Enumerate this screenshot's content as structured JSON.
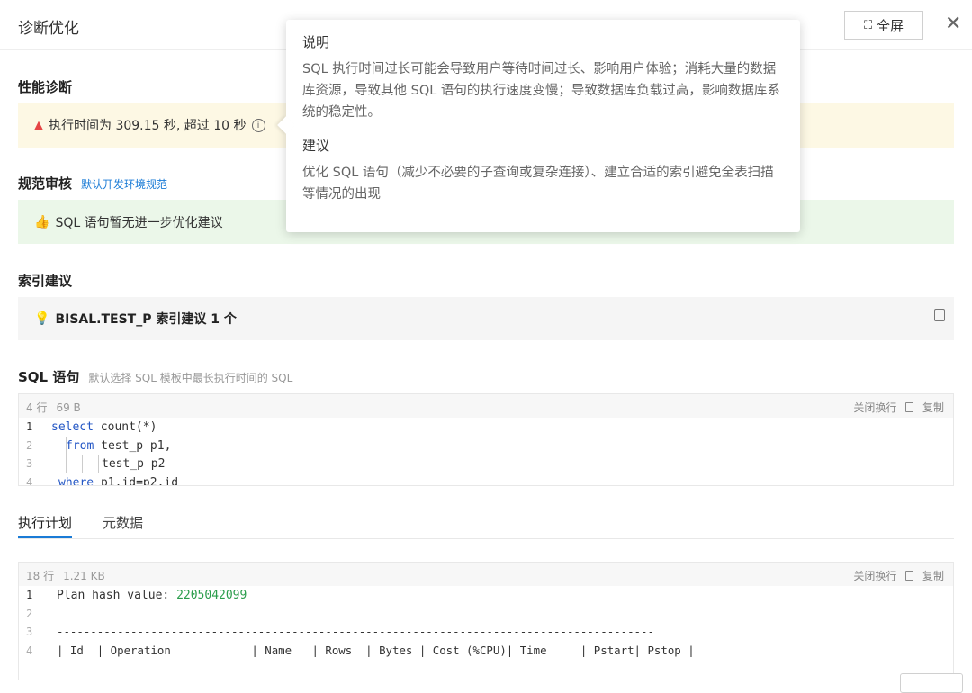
{
  "header": {
    "title": "诊断优化",
    "fullscreen_label": "全屏",
    "fullscreen_icon": "⛶"
  },
  "perf": {
    "title": "性能诊断",
    "warning": "执行时间为 309.15 秒, 超过 10 秒"
  },
  "review": {
    "title": "规范审核",
    "link": "默认开发环境规范",
    "message": "SQL 语句暂无进一步优化建议"
  },
  "index": {
    "title": "索引建议",
    "text": "BISAL.TEST_P 索引建议 1 个"
  },
  "sql": {
    "title": "SQL 语句",
    "subtitle": "默认选择 SQL 模板中最长执行时间的 SQL",
    "lines_count": "4 行",
    "size": "69 B",
    "wrap_label": "关闭换行",
    "copy_label": "复制",
    "lines": [
      {
        "n": "1",
        "kw": "select",
        "rest": " count(*)"
      },
      {
        "n": "2",
        "kw": "from",
        "rest": " test_p p1,"
      },
      {
        "n": "3",
        "kw": "",
        "rest": "test_p p2"
      },
      {
        "n": "4",
        "kw": "where",
        "rest": " p1.id=p2.id"
      }
    ]
  },
  "tabs": [
    {
      "label": "执行计划"
    },
    {
      "label": "元数据"
    }
  ],
  "plan": {
    "lines_count": "18 行",
    "size": "1.21 KB",
    "wrap_label": "关闭换行",
    "copy_label": "复制",
    "line1_label": "Plan hash value: ",
    "line1_value": "2205042099",
    "line3": "-----------------------------------------------------------------------------------------",
    "line4": "| Id  | Operation            | Name   | Rows  | Bytes | Cost (%CPU)| Time     | Pstart| Pstop |",
    "line_numbers": [
      "1",
      "2",
      "3",
      "4"
    ]
  },
  "tooltip": {
    "h1": "说明",
    "p1": "SQL 执行时间过长可能会导致用户等待时间过长、影响用户体验；消耗大量的数据库资源，导致其他 SQL 语句的执行速度变慢；导致数据库负载过高，影响数据库系统的稳定性。",
    "h2": "建议",
    "p2": "优化 SQL 语句（减少不必要的子查询或复杂连接）、建立合适的索引避免全表扫描等情况的出现"
  },
  "colors": {
    "accent": "#1a7bd6",
    "warn_bg": "#fdf8e4",
    "ok_bg": "#ebf7e9",
    "danger": "#e54545",
    "success": "#2ea44f"
  }
}
